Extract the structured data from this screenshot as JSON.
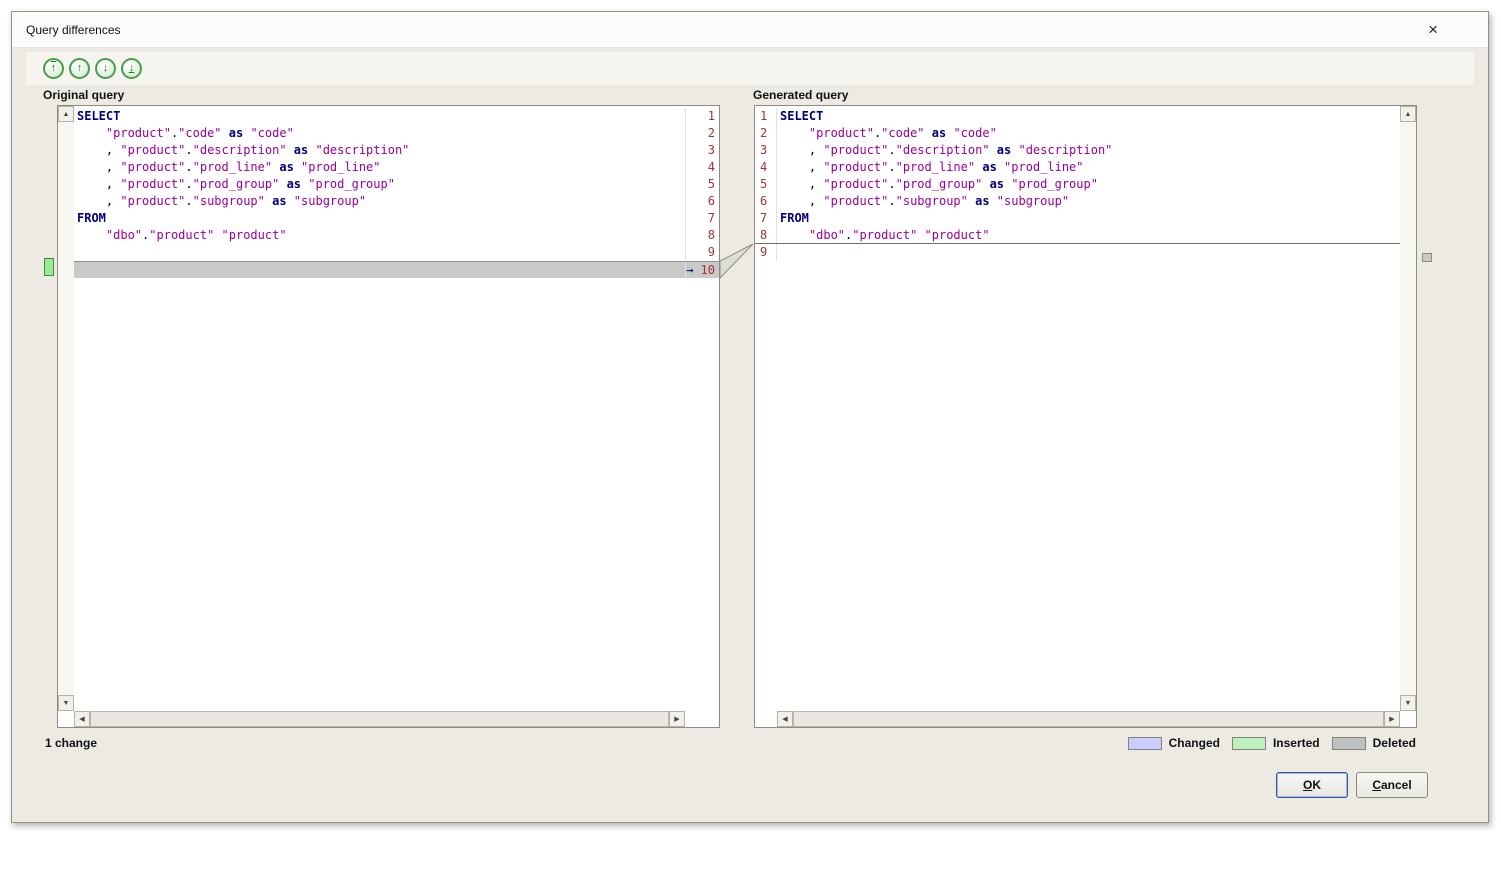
{
  "window": {
    "title": "Query differences",
    "close_glyph": "×"
  },
  "toolbar": {
    "buttons": [
      {
        "name": "first-change-button",
        "glyph": "↑",
        "variant": "first"
      },
      {
        "name": "previous-change-button",
        "glyph": "↑",
        "variant": "prev"
      },
      {
        "name": "next-change-button",
        "glyph": "↓",
        "variant": "next"
      },
      {
        "name": "last-change-button",
        "glyph": "↓",
        "variant": "last"
      }
    ]
  },
  "panels": {
    "left": {
      "label": "Original query",
      "lines": [
        {
          "num": 1,
          "segs": [
            {
              "c": "kw",
              "t": "SELECT"
            }
          ]
        },
        {
          "num": 2,
          "segs": [
            {
              "c": "pl",
              "t": "    "
            },
            {
              "c": "str",
              "t": "\"product\""
            },
            {
              "c": "pl",
              "t": "."
            },
            {
              "c": "str",
              "t": "\"code\""
            },
            {
              "c": "pl",
              "t": " "
            },
            {
              "c": "kw",
              "t": "as"
            },
            {
              "c": "pl",
              "t": " "
            },
            {
              "c": "str",
              "t": "\"code\""
            }
          ]
        },
        {
          "num": 3,
          "segs": [
            {
              "c": "pl",
              "t": "    , "
            },
            {
              "c": "str",
              "t": "\"product\""
            },
            {
              "c": "pl",
              "t": "."
            },
            {
              "c": "str",
              "t": "\"description\""
            },
            {
              "c": "pl",
              "t": " "
            },
            {
              "c": "kw",
              "t": "as"
            },
            {
              "c": "pl",
              "t": " "
            },
            {
              "c": "str",
              "t": "\"description\""
            }
          ]
        },
        {
          "num": 4,
          "segs": [
            {
              "c": "pl",
              "t": "    , "
            },
            {
              "c": "str",
              "t": "\"product\""
            },
            {
              "c": "pl",
              "t": "."
            },
            {
              "c": "str",
              "t": "\"prod_line\""
            },
            {
              "c": "pl",
              "t": " "
            },
            {
              "c": "kw",
              "t": "as"
            },
            {
              "c": "pl",
              "t": " "
            },
            {
              "c": "str",
              "t": "\"prod_line\""
            }
          ]
        },
        {
          "num": 5,
          "segs": [
            {
              "c": "pl",
              "t": "    , "
            },
            {
              "c": "str",
              "t": "\"product\""
            },
            {
              "c": "pl",
              "t": "."
            },
            {
              "c": "str",
              "t": "\"prod_group\""
            },
            {
              "c": "pl",
              "t": " "
            },
            {
              "c": "kw",
              "t": "as"
            },
            {
              "c": "pl",
              "t": " "
            },
            {
              "c": "str",
              "t": "\"prod_group\""
            }
          ]
        },
        {
          "num": 6,
          "segs": [
            {
              "c": "pl",
              "t": "    , "
            },
            {
              "c": "str",
              "t": "\"product\""
            },
            {
              "c": "pl",
              "t": "."
            },
            {
              "c": "str",
              "t": "\"subgroup\""
            },
            {
              "c": "pl",
              "t": " "
            },
            {
              "c": "kw",
              "t": "as"
            },
            {
              "c": "pl",
              "t": " "
            },
            {
              "c": "str",
              "t": "\"subgroup\""
            }
          ]
        },
        {
          "num": 7,
          "segs": [
            {
              "c": "kw",
              "t": "FROM"
            }
          ]
        },
        {
          "num": 8,
          "segs": [
            {
              "c": "pl",
              "t": "    "
            },
            {
              "c": "str",
              "t": "\"dbo\""
            },
            {
              "c": "pl",
              "t": "."
            },
            {
              "c": "str",
              "t": "\"product\""
            },
            {
              "c": "pl",
              "t": " "
            },
            {
              "c": "str",
              "t": "\"product\""
            }
          ]
        },
        {
          "num": 9,
          "segs": []
        },
        {
          "num": 10,
          "segs": [],
          "highlight": "deleted",
          "marker": "→"
        }
      ]
    },
    "right": {
      "label": "Generated query",
      "lines": [
        {
          "num": 1,
          "segs": [
            {
              "c": "kw",
              "t": "SELECT"
            }
          ]
        },
        {
          "num": 2,
          "segs": [
            {
              "c": "pl",
              "t": "    "
            },
            {
              "c": "str",
              "t": "\"product\""
            },
            {
              "c": "pl",
              "t": "."
            },
            {
              "c": "str",
              "t": "\"code\""
            },
            {
              "c": "pl",
              "t": " "
            },
            {
              "c": "kw",
              "t": "as"
            },
            {
              "c": "pl",
              "t": " "
            },
            {
              "c": "str",
              "t": "\"code\""
            }
          ]
        },
        {
          "num": 3,
          "segs": [
            {
              "c": "pl",
              "t": "    , "
            },
            {
              "c": "str",
              "t": "\"product\""
            },
            {
              "c": "pl",
              "t": "."
            },
            {
              "c": "str",
              "t": "\"description\""
            },
            {
              "c": "pl",
              "t": " "
            },
            {
              "c": "kw",
              "t": "as"
            },
            {
              "c": "pl",
              "t": " "
            },
            {
              "c": "str",
              "t": "\"description\""
            }
          ]
        },
        {
          "num": 4,
          "segs": [
            {
              "c": "pl",
              "t": "    , "
            },
            {
              "c": "str",
              "t": "\"product\""
            },
            {
              "c": "pl",
              "t": "."
            },
            {
              "c": "str",
              "t": "\"prod_line\""
            },
            {
              "c": "pl",
              "t": " "
            },
            {
              "c": "kw",
              "t": "as"
            },
            {
              "c": "pl",
              "t": " "
            },
            {
              "c": "str",
              "t": "\"prod_line\""
            }
          ]
        },
        {
          "num": 5,
          "segs": [
            {
              "c": "pl",
              "t": "    , "
            },
            {
              "c": "str",
              "t": "\"product\""
            },
            {
              "c": "pl",
              "t": "."
            },
            {
              "c": "str",
              "t": "\"prod_group\""
            },
            {
              "c": "pl",
              "t": " "
            },
            {
              "c": "kw",
              "t": "as"
            },
            {
              "c": "pl",
              "t": " "
            },
            {
              "c": "str",
              "t": "\"prod_group\""
            }
          ]
        },
        {
          "num": 6,
          "segs": [
            {
              "c": "pl",
              "t": "    , "
            },
            {
              "c": "str",
              "t": "\"product\""
            },
            {
              "c": "pl",
              "t": "."
            },
            {
              "c": "str",
              "t": "\"subgroup\""
            },
            {
              "c": "pl",
              "t": " "
            },
            {
              "c": "kw",
              "t": "as"
            },
            {
              "c": "pl",
              "t": " "
            },
            {
              "c": "str",
              "t": "\"subgroup\""
            }
          ]
        },
        {
          "num": 7,
          "segs": [
            {
              "c": "kw",
              "t": "FROM"
            }
          ]
        },
        {
          "num": 8,
          "segs": [
            {
              "c": "pl",
              "t": "    "
            },
            {
              "c": "str",
              "t": "\"dbo\""
            },
            {
              "c": "pl",
              "t": "."
            },
            {
              "c": "str",
              "t": "\"product\""
            },
            {
              "c": "pl",
              "t": " "
            },
            {
              "c": "str",
              "t": "\"product\""
            }
          ],
          "divider_after": true
        },
        {
          "num": 9,
          "segs": []
        }
      ]
    }
  },
  "status": {
    "summary": "1 change"
  },
  "legend": [
    {
      "label": "Changed",
      "color": "#CCCCFF"
    },
    {
      "label": "Inserted",
      "color": "#BDF0BD"
    },
    {
      "label": "Deleted",
      "color": "#C0C0C0"
    }
  ],
  "buttons": [
    {
      "name": "ok-button",
      "label": "OK"
    },
    {
      "name": "cancel-button",
      "label": "Cancel"
    }
  ]
}
